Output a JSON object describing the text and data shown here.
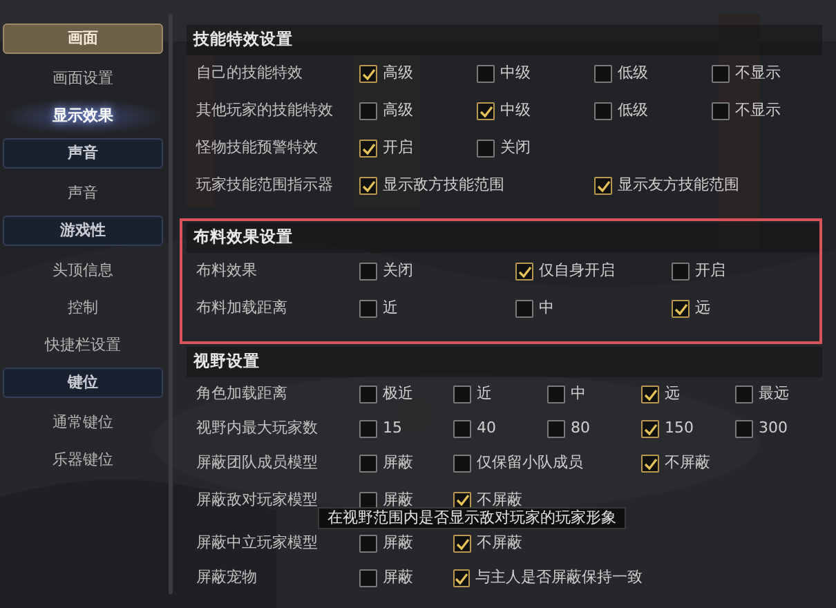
{
  "sidebar": {
    "groups": [
      {
        "label": "画面",
        "selected": true,
        "items": [
          {
            "label": "画面设置",
            "selected": false
          },
          {
            "label": "显示效果",
            "selected": true
          }
        ]
      },
      {
        "label": "声音",
        "selected": false,
        "items": [
          {
            "label": "声音",
            "selected": false
          }
        ]
      },
      {
        "label": "游戏性",
        "selected": false,
        "items": [
          {
            "label": "头顶信息",
            "selected": false
          },
          {
            "label": "控制",
            "selected": false
          },
          {
            "label": "快捷栏设置",
            "selected": false
          }
        ]
      },
      {
        "label": "键位",
        "selected": false,
        "items": [
          {
            "label": "通常键位",
            "selected": false
          },
          {
            "label": "乐器键位",
            "selected": false
          }
        ]
      }
    ]
  },
  "sections": [
    {
      "title": "技能特效设置",
      "highlighted": false,
      "rows": [
        {
          "label": "自己的技能特效",
          "options": [
            {
              "label": "高级",
              "checked": true
            },
            {
              "label": "中级",
              "checked": false
            },
            {
              "label": "低级",
              "checked": false
            },
            {
              "label": "不显示",
              "checked": false
            }
          ]
        },
        {
          "label": "其他玩家的技能特效",
          "options": [
            {
              "label": "高级",
              "checked": false
            },
            {
              "label": "中级",
              "checked": true
            },
            {
              "label": "低级",
              "checked": false
            },
            {
              "label": "不显示",
              "checked": false
            }
          ]
        },
        {
          "label": "怪物技能预警特效",
          "options": [
            {
              "label": "开启",
              "checked": true
            },
            {
              "label": "关闭",
              "checked": false
            }
          ]
        },
        {
          "label": "玩家技能范围指示器",
          "options": [
            {
              "label": "显示敌方技能范围",
              "checked": true
            },
            {
              "label": "显示友方技能范围",
              "checked": true
            }
          ]
        }
      ]
    },
    {
      "title": "布料效果设置",
      "highlighted": true,
      "rows": [
        {
          "label": "布料效果",
          "options": [
            {
              "label": "关闭",
              "checked": false
            },
            {
              "label": "仅自身开启",
              "checked": true
            },
            {
              "label": "开启",
              "checked": false
            }
          ]
        },
        {
          "label": "布料加载距离",
          "options": [
            {
              "label": "近",
              "checked": false
            },
            {
              "label": "中",
              "checked": false
            },
            {
              "label": "远",
              "checked": true
            }
          ]
        }
      ]
    },
    {
      "title": "视野设置",
      "highlighted": false,
      "rows": [
        {
          "label": "角色加载距离",
          "options": [
            {
              "label": "极近",
              "checked": false
            },
            {
              "label": "近",
              "checked": false
            },
            {
              "label": "中",
              "checked": false
            },
            {
              "label": "远",
              "checked": true
            },
            {
              "label": "最远",
              "checked": false
            }
          ]
        },
        {
          "label": "视野内最大玩家数",
          "options": [
            {
              "label": "15",
              "checked": false
            },
            {
              "label": "40",
              "checked": false
            },
            {
              "label": "80",
              "checked": false
            },
            {
              "label": "150",
              "checked": true
            },
            {
              "label": "300",
              "checked": false
            }
          ]
        },
        {
          "label": "屏蔽团队成员模型",
          "options": [
            {
              "label": "屏蔽",
              "checked": false
            },
            {
              "label": "仅保留小队成员",
              "checked": false
            },
            {
              "label": "不屏蔽",
              "checked": true
            }
          ]
        },
        {
          "label": "屏蔽敌对玩家模型",
          "options": [
            {
              "label": "屏蔽",
              "checked": false
            },
            {
              "label": "不屏蔽",
              "checked": true
            }
          ],
          "tooltip": "在视野范围内是否显示敌对玩家的玩家形象"
        },
        {
          "label": "屏蔽中立玩家模型",
          "options": [
            {
              "label": "屏蔽",
              "checked": false
            },
            {
              "label": "不屏蔽",
              "checked": true
            }
          ]
        },
        {
          "label": "屏蔽宠物",
          "options": [
            {
              "label": "屏蔽",
              "checked": false
            },
            {
              "label": "与主人是否屏蔽保持一致",
              "checked": true
            }
          ]
        }
      ]
    }
  ]
}
